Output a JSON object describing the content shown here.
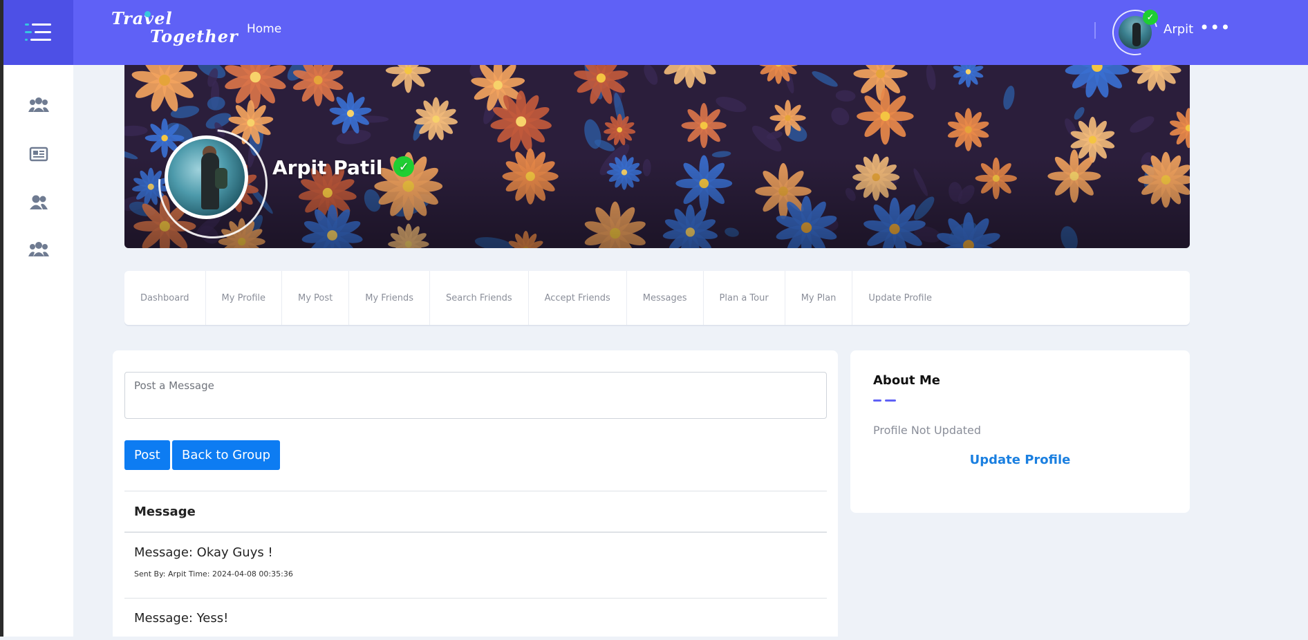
{
  "header": {
    "logo_line1": "Travel",
    "logo_line2": "Together",
    "home_label": "Home",
    "username": "Arpit",
    "more_label": "•••"
  },
  "sidebar": {
    "icons": [
      "groups-icon",
      "newspaper-icon",
      "friends-icon",
      "groups-icon"
    ]
  },
  "profile": {
    "name": "Arpit Patil",
    "verified": true
  },
  "tabs": [
    {
      "label": "Dashboard"
    },
    {
      "label": "My Profile"
    },
    {
      "label": "My Post"
    },
    {
      "label": "My Friends"
    },
    {
      "label": "Search Friends"
    },
    {
      "label": "Accept Friends"
    },
    {
      "label": "Messages"
    },
    {
      "label": "Plan a Tour"
    },
    {
      "label": "My Plan"
    },
    {
      "label": "Update Profile"
    }
  ],
  "post_form": {
    "placeholder": "Post a Message",
    "value": "",
    "post_button": "Post",
    "back_button": "Back to Group"
  },
  "messages": {
    "header": "Message",
    "rows": [
      {
        "text": "Message: Okay Guys !",
        "meta": "Sent By: Arpit Time: 2024-04-08 00:35:36"
      },
      {
        "text": "Message: Yess!",
        "meta": ""
      }
    ]
  },
  "about": {
    "title": "About Me",
    "status": "Profile Not Updated",
    "link_label": "Update Profile"
  },
  "colors": {
    "header_bg": "#5f61f6",
    "menu_square": "#4d50e6",
    "button": "#0d7cf2",
    "verified": "#1fce32",
    "link": "#1a7fe0"
  }
}
